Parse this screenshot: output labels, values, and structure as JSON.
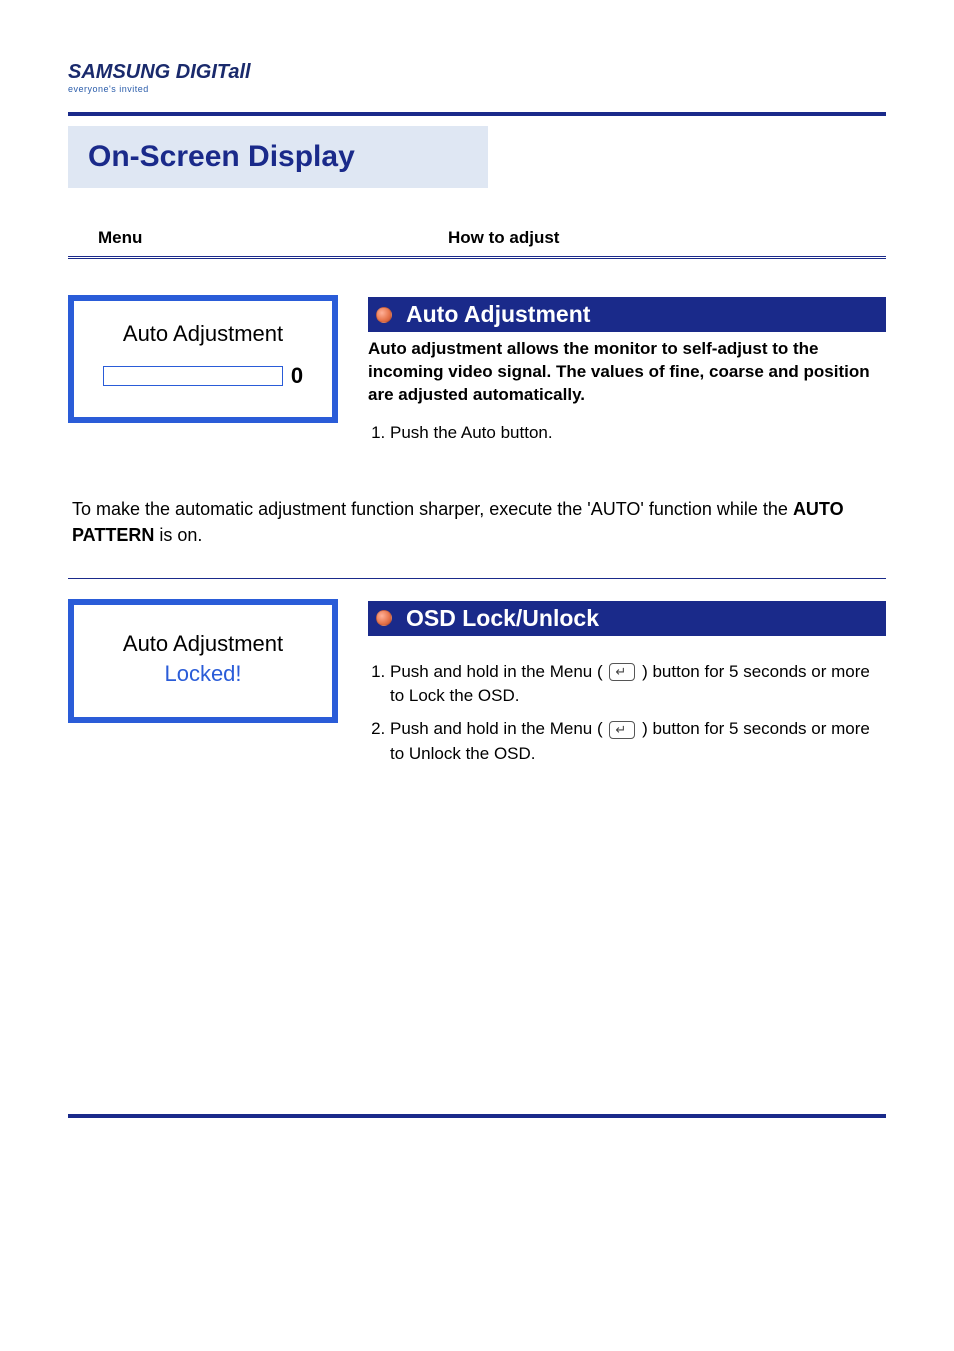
{
  "logo": {
    "brand": "SAMSUNG DIGITall",
    "tagline": "everyone's invited"
  },
  "page_title": "On-Screen Display",
  "headers": {
    "col1": "Menu",
    "col2": "How to adjust"
  },
  "section1": {
    "osd": {
      "title": "Auto Adjustment",
      "progress_value": "0"
    },
    "heading": "Auto Adjustment",
    "description": "Auto adjustment allows the monitor to self-adjust to the incoming video signal. The values of fine, coarse and position are adjusted automatically.",
    "steps": [
      "Push the Auto button."
    ]
  },
  "footnote": {
    "prefix": "To make the automatic adjustment function sharper, execute the 'AUTO' function while the ",
    "bold": "AUTO PATTERN",
    "suffix": " is on."
  },
  "section2": {
    "osd": {
      "title": "Auto Adjustment",
      "locked": "Locked!"
    },
    "heading": "OSD Lock/Unlock",
    "steps": [
      {
        "pre": "Push and hold in the Menu ( ",
        "post": " ) button for 5 seconds or more to Lock the OSD."
      },
      {
        "pre": "Push and hold in the Menu ( ",
        "post": " ) button for 5 seconds or more to Unlock the OSD."
      }
    ]
  }
}
